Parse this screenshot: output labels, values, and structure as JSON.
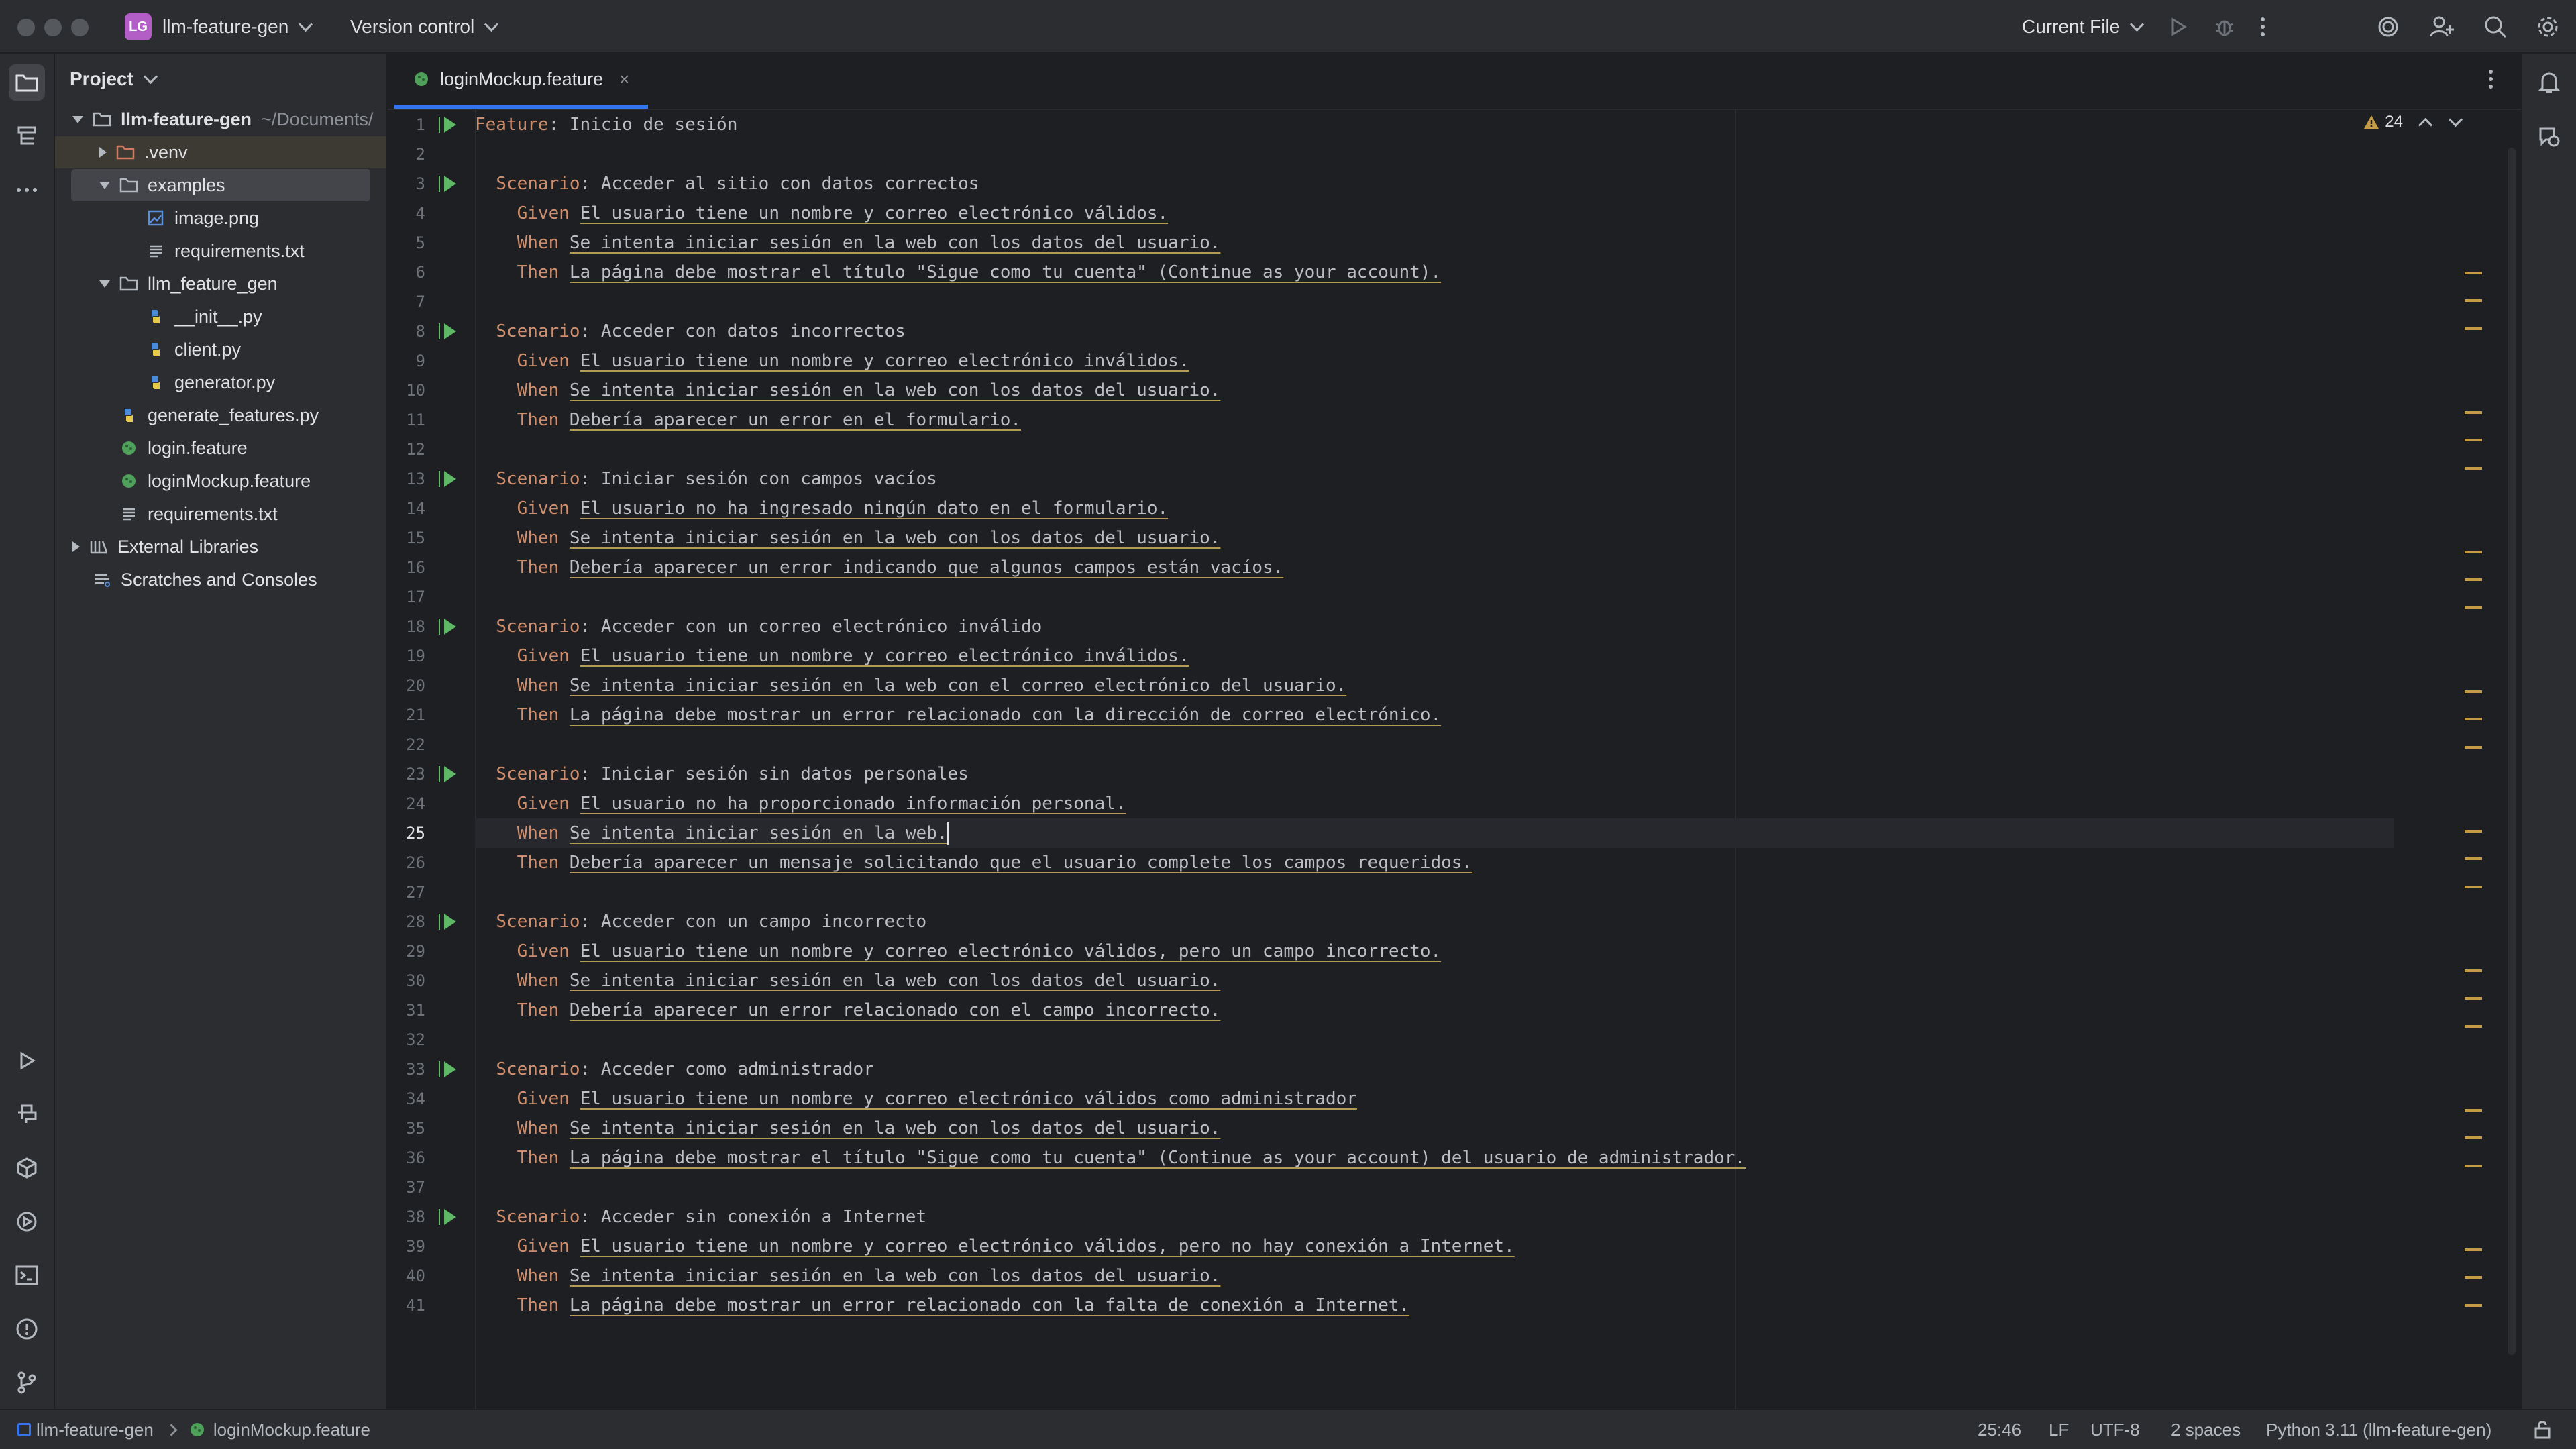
{
  "titlebar": {
    "project_badge": "LG",
    "project_name": "llm-feature-gen",
    "vcs": "Version control",
    "run_config": "Current File"
  },
  "project_panel": {
    "header": "Project",
    "tree": [
      {
        "label": "llm-feature-gen",
        "suffix": "~/Documents/",
        "depth": 0,
        "type": "folder",
        "expanded": true,
        "bold": true
      },
      {
        "label": ".venv",
        "depth": 1,
        "type": "folder-excluded",
        "expanded": false
      },
      {
        "label": "examples",
        "depth": 1,
        "type": "folder",
        "expanded": true,
        "selected": true
      },
      {
        "label": "image.png",
        "depth": 2,
        "type": "image"
      },
      {
        "label": "requirements.txt",
        "depth": 2,
        "type": "text"
      },
      {
        "label": "llm_feature_gen",
        "depth": 1,
        "type": "folder",
        "expanded": true
      },
      {
        "label": "__init__.py",
        "depth": 2,
        "type": "python"
      },
      {
        "label": "client.py",
        "depth": 2,
        "type": "python"
      },
      {
        "label": "generator.py",
        "depth": 2,
        "type": "python"
      },
      {
        "label": "generate_features.py",
        "depth": 1,
        "type": "python"
      },
      {
        "label": "login.feature",
        "depth": 1,
        "type": "feature"
      },
      {
        "label": "loginMockup.feature",
        "depth": 1,
        "type": "feature"
      },
      {
        "label": "requirements.txt",
        "depth": 1,
        "type": "text"
      },
      {
        "label": "External Libraries",
        "depth": 0,
        "type": "library",
        "expanded": false
      },
      {
        "label": "Scratches and Consoles",
        "depth": 0,
        "type": "scratch"
      }
    ]
  },
  "editor": {
    "tab_label": "loginMockup.feature",
    "close_glyph": "×",
    "warnings_count": "24",
    "current_line": 25,
    "run_lines": [
      1,
      3,
      8,
      13,
      18,
      23,
      28,
      33,
      38
    ],
    "lines": [
      {
        "n": 1,
        "kw": "Feature",
        "sep": ": ",
        "text": "Inicio de sesión",
        "indent": 0
      },
      {
        "n": 2,
        "kw": "",
        "text": "",
        "indent": 0
      },
      {
        "n": 3,
        "kw": "Scenario",
        "sep": ": ",
        "text": "Acceder al sitio con datos correctos",
        "indent": 2
      },
      {
        "n": 4,
        "kw": "Given",
        "sep": " ",
        "text": "El usuario tiene un nombre y correo electrónico válidos.",
        "indent": 4,
        "step": true
      },
      {
        "n": 5,
        "kw": "When",
        "sep": " ",
        "text": "Se intenta iniciar sesión en la web con los datos del usuario.",
        "indent": 4,
        "step": true
      },
      {
        "n": 6,
        "kw": "Then",
        "sep": " ",
        "text": "La página debe mostrar el título \"Sigue como tu cuenta\" (Continue as your account).",
        "indent": 4,
        "step": true
      },
      {
        "n": 7,
        "kw": "",
        "text": "",
        "indent": 0
      },
      {
        "n": 8,
        "kw": "Scenario",
        "sep": ": ",
        "text": "Acceder con datos incorrectos",
        "indent": 2
      },
      {
        "n": 9,
        "kw": "Given",
        "sep": " ",
        "text": "El usuario tiene un nombre y correo electrónico inválidos.",
        "indent": 4,
        "step": true
      },
      {
        "n": 10,
        "kw": "When",
        "sep": " ",
        "text": "Se intenta iniciar sesión en la web con los datos del usuario.",
        "indent": 4,
        "step": true
      },
      {
        "n": 11,
        "kw": "Then",
        "sep": " ",
        "text": "Debería aparecer un error en el formulario.",
        "indent": 4,
        "step": true
      },
      {
        "n": 12,
        "kw": "",
        "text": "",
        "indent": 0
      },
      {
        "n": 13,
        "kw": "Scenario",
        "sep": ": ",
        "text": "Iniciar sesión con campos vacíos",
        "indent": 2
      },
      {
        "n": 14,
        "kw": "Given",
        "sep": " ",
        "text": "El usuario no ha ingresado ningún dato en el formulario.",
        "indent": 4,
        "step": true
      },
      {
        "n": 15,
        "kw": "When",
        "sep": " ",
        "text": "Se intenta iniciar sesión en la web con los datos del usuario.",
        "indent": 4,
        "step": true
      },
      {
        "n": 16,
        "kw": "Then",
        "sep": " ",
        "text": "Debería aparecer un error indicando que algunos campos están vacíos.",
        "indent": 4,
        "step": true
      },
      {
        "n": 17,
        "kw": "",
        "text": "",
        "indent": 0
      },
      {
        "n": 18,
        "kw": "Scenario",
        "sep": ": ",
        "text": "Acceder con un correo electrónico inválido",
        "indent": 2
      },
      {
        "n": 19,
        "kw": "Given",
        "sep": " ",
        "text": "El usuario tiene un nombre y correo electrónico inválidos.",
        "indent": 4,
        "step": true
      },
      {
        "n": 20,
        "kw": "When",
        "sep": " ",
        "text": "Se intenta iniciar sesión en la web con el correo electrónico del usuario.",
        "indent": 4,
        "step": true
      },
      {
        "n": 21,
        "kw": "Then",
        "sep": " ",
        "text": "La página debe mostrar un error relacionado con la dirección de correo electrónico.",
        "indent": 4,
        "step": true
      },
      {
        "n": 22,
        "kw": "",
        "text": "",
        "indent": 0
      },
      {
        "n": 23,
        "kw": "Scenario",
        "sep": ": ",
        "text": "Iniciar sesión sin datos personales",
        "indent": 2
      },
      {
        "n": 24,
        "kw": "Given",
        "sep": " ",
        "text": "El usuario no ha proporcionado información personal.",
        "indent": 4,
        "step": true
      },
      {
        "n": 25,
        "kw": "When",
        "sep": " ",
        "text": "Se intenta iniciar sesión en la web.",
        "indent": 4,
        "step": true
      },
      {
        "n": 26,
        "kw": "Then",
        "sep": " ",
        "text": "Debería aparecer un mensaje solicitando que el usuario complete los campos requeridos.",
        "indent": 4,
        "step": true
      },
      {
        "n": 27,
        "kw": "",
        "text": "",
        "indent": 0
      },
      {
        "n": 28,
        "kw": "Scenario",
        "sep": ": ",
        "text": "Acceder con un campo incorrecto",
        "indent": 2
      },
      {
        "n": 29,
        "kw": "Given",
        "sep": " ",
        "text": "El usuario tiene un nombre y correo electrónico válidos, pero un campo incorrecto.",
        "indent": 4,
        "step": true
      },
      {
        "n": 30,
        "kw": "When",
        "sep": " ",
        "text": "Se intenta iniciar sesión en la web con los datos del usuario.",
        "indent": 4,
        "step": true
      },
      {
        "n": 31,
        "kw": "Then",
        "sep": " ",
        "text": "Debería aparecer un error relacionado con el campo incorrecto.",
        "indent": 4,
        "step": true
      },
      {
        "n": 32,
        "kw": "",
        "text": "",
        "indent": 0
      },
      {
        "n": 33,
        "kw": "Scenario",
        "sep": ": ",
        "text": "Acceder como administrador",
        "indent": 2
      },
      {
        "n": 34,
        "kw": "Given",
        "sep": " ",
        "text": "El usuario tiene un nombre y correo electrónico válidos como administrador",
        "indent": 4,
        "step": true
      },
      {
        "n": 35,
        "kw": "When",
        "sep": " ",
        "text": "Se intenta iniciar sesión en la web con los datos del usuario.",
        "indent": 4,
        "step": true
      },
      {
        "n": 36,
        "kw": "Then",
        "sep": " ",
        "text": "La página debe mostrar el título \"Sigue como tu cuenta\" (Continue as your account) del usuario de administrador.",
        "indent": 4,
        "step": true
      },
      {
        "n": 37,
        "kw": "",
        "text": "",
        "indent": 0
      },
      {
        "n": 38,
        "kw": "Scenario",
        "sep": ": ",
        "text": "Acceder sin conexión a Internet",
        "indent": 2
      },
      {
        "n": 39,
        "kw": "Given",
        "sep": " ",
        "text": "El usuario tiene un nombre y correo electrónico válidos, pero no hay conexión a Internet.",
        "indent": 4,
        "step": true
      },
      {
        "n": 40,
        "kw": "When",
        "sep": " ",
        "text": "Se intenta iniciar sesión en la web con los datos del usuario.",
        "indent": 4,
        "step": true
      },
      {
        "n": 41,
        "kw": "Then",
        "sep": " ",
        "text": "La página debe mostrar un error relacionado con la falta de conexión a Internet.",
        "indent": 4,
        "step": true
      }
    ]
  },
  "statusbar": {
    "breadcrumb_project": "llm-feature-gen",
    "breadcrumb_file": "loginMockup.feature",
    "position": "25:46",
    "line_sep": "LF",
    "encoding": "UTF-8",
    "indent": "2 spaces",
    "interpreter": "Python 3.11 (llm-feature-gen)"
  },
  "colors": {
    "background": "#1e1f22",
    "panel": "#2b2d30",
    "keyword": "#cf8e6d",
    "run_gutter": "#5fb865",
    "accent": "#3574f0",
    "warning": "#c49c45"
  }
}
